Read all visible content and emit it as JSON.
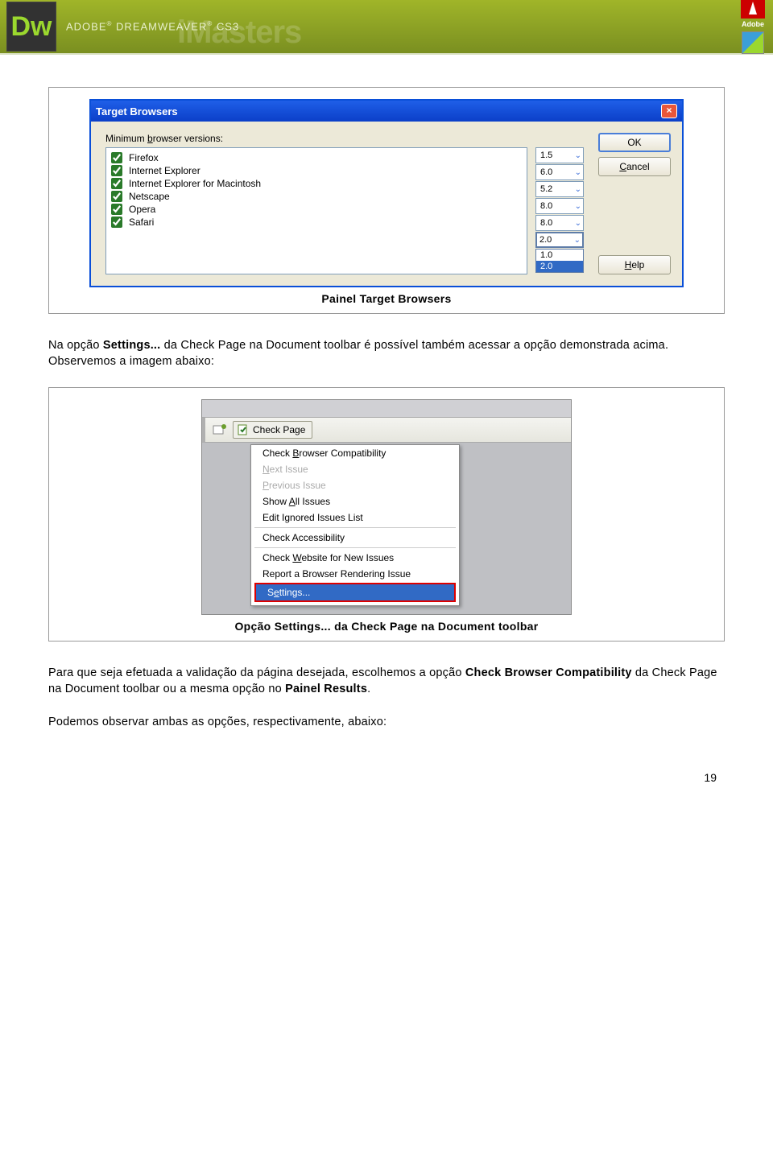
{
  "header": {
    "dw_logo": "Dw",
    "product_line1": "ADOBE",
    "product_line2": "DREAMWEAVER",
    "product_line3": "CS3",
    "watermark": "iMasters",
    "adobe": "Adobe"
  },
  "dialog": {
    "title": "Target Browsers",
    "min_versions_label": "Minimum browser versions:",
    "browsers": [
      {
        "name": "Firefox",
        "version": "1.5",
        "checked": true
      },
      {
        "name": "Internet Explorer",
        "version": "6.0",
        "checked": true
      },
      {
        "name": "Internet Explorer for Macintosh",
        "version": "5.2",
        "checked": true
      },
      {
        "name": "Netscape",
        "version": "8.0",
        "checked": true
      },
      {
        "name": "Opera",
        "version": "8.0",
        "checked": true
      },
      {
        "name": "Safari",
        "version": "2.0",
        "checked": true
      }
    ],
    "dropdown_options": [
      "1.0",
      "2.0"
    ],
    "dropdown_selected": "2.0",
    "ok": "OK",
    "cancel": "Cancel",
    "help": "Help"
  },
  "captions": {
    "fig1": "Painel Target Browsers",
    "fig2": "Opção Settings... da Check Page na Document toolbar"
  },
  "paragraphs": {
    "p1_a": "Na opção ",
    "p1_b": "Settings...",
    "p1_c": " da Check Page na Document toolbar é possível também acessar a opção demonstrada acima. Observemos a imagem abaixo:",
    "p2_a": "Para que seja efetuada a validação da página desejada, escolhemos a opção ",
    "p2_b": "Check Browser Compatibility",
    "p2_c": " da Check Page na Document toolbar ou a mesma opção no ",
    "p2_d": "Painel Results",
    "p2_e": ".",
    "p3": "Podemos observar ambas as opções, respectivamente, abaixo:"
  },
  "menu": {
    "toolbar_button": "Check Page",
    "items": [
      {
        "label": "Check Browser Compatibility",
        "disabled": false
      },
      {
        "label": "Next Issue",
        "disabled": true
      },
      {
        "label": "Previous Issue",
        "disabled": true
      },
      {
        "label": "Show All Issues",
        "disabled": false
      },
      {
        "label": "Edit Ignored Issues List",
        "disabled": false
      }
    ],
    "items2": [
      {
        "label": "Check Accessibility",
        "disabled": false
      }
    ],
    "items3": [
      {
        "label": "Check Website for New Issues",
        "disabled": false
      },
      {
        "label": "Report a Browser Rendering Issue",
        "disabled": false
      }
    ],
    "highlighted": "Settings..."
  },
  "page_number": "19"
}
